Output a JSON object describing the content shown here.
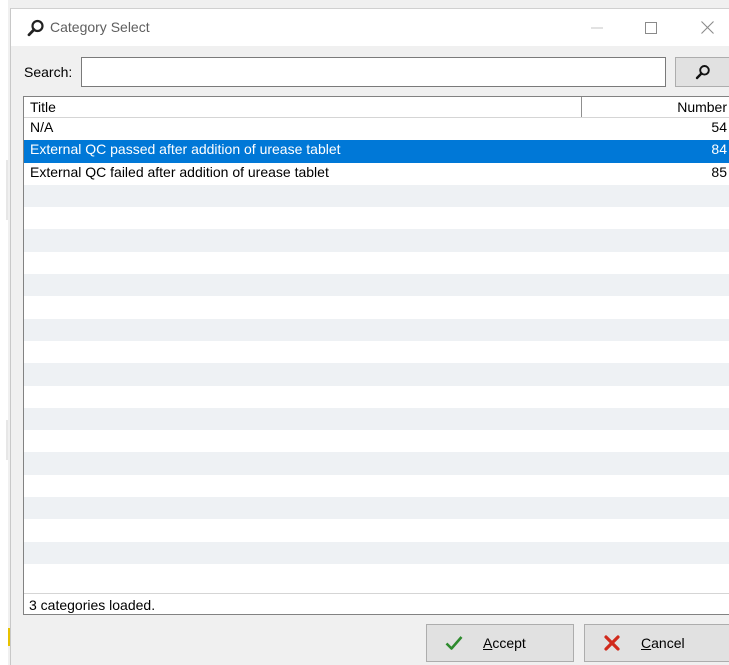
{
  "window": {
    "title": "Category Select",
    "icon": "search-icon"
  },
  "search": {
    "label": "Search:",
    "value": "",
    "placeholder": "",
    "button_icon": "search-icon"
  },
  "table": {
    "columns": [
      "Title",
      "Number"
    ],
    "rows": [
      {
        "title": "N/A",
        "number": "54",
        "selected": false
      },
      {
        "title": "External QC passed after addition of urease tablet",
        "number": "84",
        "selected": true
      },
      {
        "title": "External QC failed after addition of urease tablet",
        "number": "85",
        "selected": false
      }
    ]
  },
  "status": {
    "text": "3 categories loaded."
  },
  "buttons": {
    "accept": {
      "label_access": "A",
      "label_rest": "ccept",
      "icon": "check-icon"
    },
    "cancel": {
      "label_access": "C",
      "label_rest": "ancel",
      "icon": "cross-icon"
    }
  },
  "colors": {
    "selection": "#0078d7",
    "check": "#2e8b2e",
    "cross": "#d12a1c"
  }
}
